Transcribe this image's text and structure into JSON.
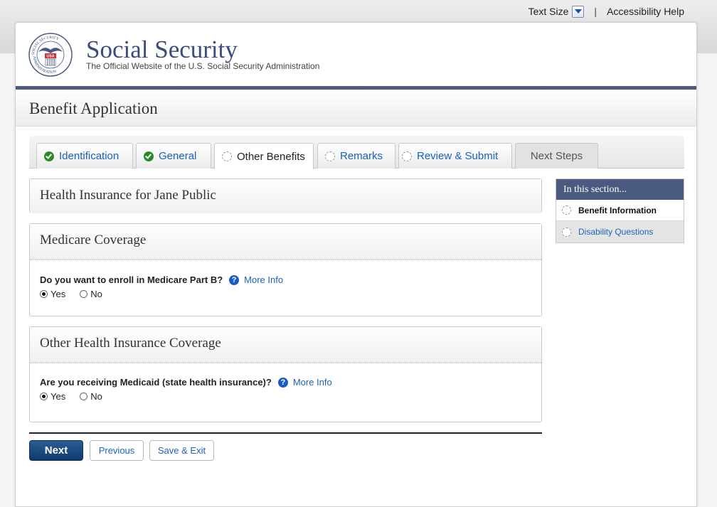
{
  "utility": {
    "text_size_label": "Text Size",
    "separator": "|",
    "accessibility_label": "Accessibility Help"
  },
  "header": {
    "seal_text_top": "SOCIAL SECURITY",
    "seal_text_bottom": "ADMINISTRATION",
    "seal_badge": "USA",
    "title": "Social Security",
    "subtitle": "The Official Website of the U.S. Social Security Administration"
  },
  "page_title": "Benefit Application",
  "tabs": [
    {
      "label": "Identification",
      "status": "complete"
    },
    {
      "label": "General",
      "status": "complete"
    },
    {
      "label": "Other Benefits",
      "status": "current"
    },
    {
      "label": "Remarks",
      "status": "incomplete"
    },
    {
      "label": "Review & Submit",
      "status": "incomplete"
    },
    {
      "label": "Next Steps",
      "status": "disabled"
    }
  ],
  "main": {
    "insurance_title": "Health Insurance for Jane Public",
    "medicare": {
      "heading": "Medicare Coverage",
      "question": "Do you want to enroll in Medicare Part B?",
      "help_icon": "?",
      "more_info": "More Info",
      "option_yes": "Yes",
      "option_no": "No",
      "selected": "Yes"
    },
    "other_insurance": {
      "heading": "Other Health Insurance Coverage",
      "question": "Are you receiving Medicaid (state health insurance)?",
      "help_icon": "?",
      "more_info": "More Info",
      "option_yes": "Yes",
      "option_no": "No",
      "selected": "Yes"
    }
  },
  "buttons": {
    "next": "Next",
    "previous": "Previous",
    "save_exit": "Save & Exit"
  },
  "sidebar": {
    "heading": "In this section...",
    "items": [
      {
        "label": "Benefit Information",
        "current": true
      },
      {
        "label": "Disability Questions",
        "current": false
      }
    ]
  },
  "colors": {
    "brand_navy": "#4a5a80",
    "link_blue": "#1a63b8",
    "complete_green": "#2a8a2a",
    "primary_button": "#0f3a6a"
  },
  "icons": [
    "chevron-down-icon",
    "ssa-seal-icon",
    "check-circle-icon",
    "empty-circle-icon",
    "help-icon",
    "radio-icon"
  ]
}
